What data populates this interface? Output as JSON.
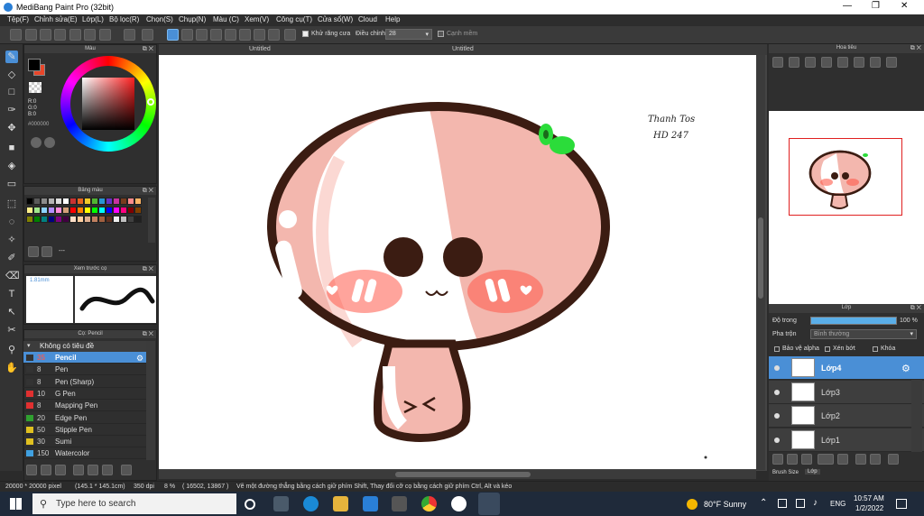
{
  "window": {
    "title": "MediBang Paint Pro (32bit)",
    "minimize": "—",
    "maximize": "❐",
    "close": "✕"
  },
  "menu": [
    "Tệp(F)",
    "Chỉnh sửa(E)",
    "Lớp(L)",
    "Bộ lọc(R)",
    "Chọn(S)",
    "Chụp(N)",
    "Màu (C)",
    "Xem(V)",
    "Công cụ(T)",
    "Cửa sổ(W)",
    "Cloud",
    "Help"
  ],
  "toolbar": {
    "antialias_label": "Khử răng cưa",
    "adjust_label": "Điều chỉnh",
    "adjust_value": "28",
    "soft_edge_label": "Cạnh mềm"
  },
  "canvas_tabs": [
    "Untitled",
    "Untitled"
  ],
  "color_panel": {
    "title": "Màu",
    "r": "R:0",
    "g": "G:0",
    "b": "B:0",
    "hex": "#000000",
    "fg_color": "#000000",
    "bg_color": "#e8462a"
  },
  "palette_panel": {
    "title": "Bảng màu",
    "more": "---",
    "swatches": [
      "#000000",
      "#5a5a5a",
      "#8c8c8c",
      "#b4b4b4",
      "#dcdcdc",
      "#ffffff",
      "#c83232",
      "#e6641e",
      "#f0c828",
      "#50b432",
      "#2896d2",
      "#6432c8",
      "#c832a0",
      "#783c1e",
      "#ff8c8c",
      "#ffb464",
      "#fff08c",
      "#a0e68c",
      "#8cd2ff",
      "#b48cff",
      "#ff8cdc",
      "#d2a078",
      "#ff0000",
      "#ff8000",
      "#ffff00",
      "#00ff00",
      "#00ffff",
      "#0000ff",
      "#ff00ff",
      "#ff0080",
      "#800000",
      "#804000",
      "#808000",
      "#008000",
      "#008080",
      "#000080",
      "#800080",
      "#400040",
      "#ffe0c8",
      "#ffd0a0",
      "#e0b090",
      "#c08060",
      "#a06040",
      "#603020",
      "#f0f0f0",
      "#c0c0c0",
      "#404040",
      "#202020"
    ]
  },
  "preview_panel": {
    "title": "Xem trước cọ",
    "size": "1.81mm"
  },
  "brush_panel": {
    "title": "Cọ: Pencil",
    "group": "Không có tiêu đề",
    "brushes": [
      {
        "size": "35",
        "name": "Pencil",
        "color": "#333333",
        "selected": true
      },
      {
        "size": "8",
        "name": "Pen",
        "color": "#333333"
      },
      {
        "size": "8",
        "name": "Pen (Sharp)",
        "color": "#333333"
      },
      {
        "size": "10",
        "name": "G Pen",
        "color": "#e03030"
      },
      {
        "size": "8",
        "name": "Mapping Pen",
        "color": "#e03030"
      },
      {
        "size": "20",
        "name": "Edge Pen",
        "color": "#30a030"
      },
      {
        "size": "50",
        "name": "Stipple Pen",
        "color": "#e0c020"
      },
      {
        "size": "30",
        "name": "Sumi",
        "color": "#e0c020"
      },
      {
        "size": "150",
        "name": "Watercolor",
        "color": "#40a0e0"
      }
    ]
  },
  "canvas": {
    "signature_line1": "Thanh Tos",
    "signature_line2": "HD 247"
  },
  "navigator_panel": {
    "title": "Hoa tiêu"
  },
  "layer_panel": {
    "title": "Lớp",
    "opacity_label": "Độ trong",
    "opacity_value": "100 %",
    "blend_label": "Pha trộn",
    "blend_value": "Bình thường",
    "protect_alpha": "Bảo vệ alpha",
    "clipping": "Xén bớt",
    "lock": "Khóa",
    "layers": [
      {
        "name": "Lớp4",
        "selected": true
      },
      {
        "name": "Lớp3"
      },
      {
        "name": "Lớp2"
      },
      {
        "name": "Lớp1"
      }
    ],
    "bottom_tabs": [
      "Brush Size",
      "Lớp"
    ]
  },
  "status": {
    "size": "20000 * 20000 pixel",
    "cm": "(145.1 * 145.1cm)",
    "dpi": "350 dpi",
    "zoom": "8 %",
    "coords": "( 16502, 13867 )",
    "hint": "Vẽ một đường thẳng bằng cách giữ phím Shift, Thay đổi cỡ cọ bằng cách giữ phím Ctrl, Alt và kéo"
  },
  "taskbar": {
    "search_placeholder": "Type here to search",
    "weather": "80°F  Sunny",
    "lang": "ENG",
    "time": "10:57 AM",
    "date": "1/2/2022"
  }
}
